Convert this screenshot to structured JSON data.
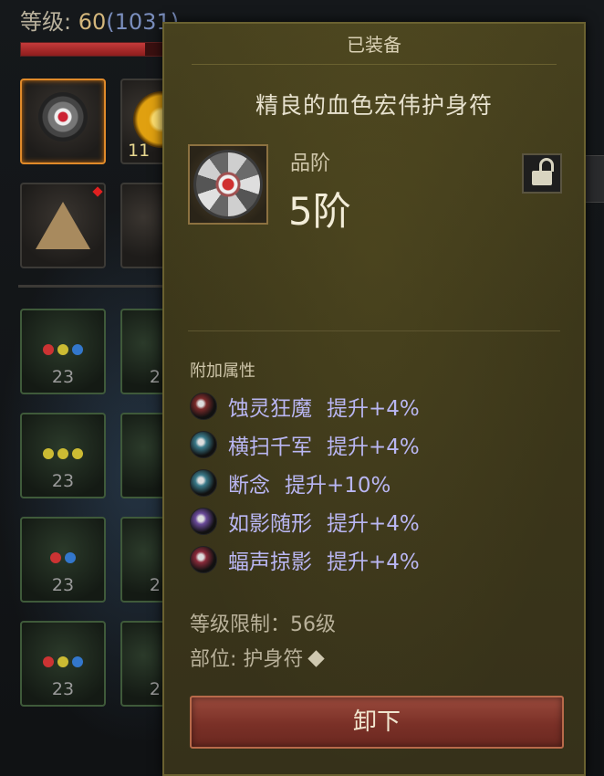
{
  "player": {
    "level_label": "等级: ",
    "level_value": "60",
    "level_extra": "(1031)",
    "hp_fraction": 0.85
  },
  "inventory": {
    "gold_count_partial": "11",
    "gem_slot_counts": [
      "23",
      "23",
      "23",
      "23"
    ],
    "partial_counts": [
      "2",
      "2",
      "2"
    ]
  },
  "tooltip": {
    "header": "已装备",
    "item_name": "精良的血色宏伟护身符",
    "grade_label": "品阶",
    "grade_value": "5阶",
    "attributes_header": "附加属性",
    "attributes": [
      {
        "name": "蚀灵狂魔",
        "bonus": "提升+4%",
        "icon": "dark-spirit-icon",
        "color": "#7a2a2a"
      },
      {
        "name": "横扫千军",
        "bonus": "提升+4%",
        "icon": "sweep-slash-icon",
        "color": "#3a7a8a"
      },
      {
        "name": "断念",
        "bonus": "提升+10%",
        "icon": "blade-icon",
        "color": "#3a7a8a"
      },
      {
        "name": "如影随形",
        "bonus": "提升+4%",
        "icon": "shadow-icon",
        "color": "#6a4a9a"
      },
      {
        "name": "蝠声掠影",
        "bonus": "提升+4%",
        "icon": "bat-swarm-icon",
        "color": "#8a2a3a"
      }
    ],
    "level_requirement": "等级限制：56级",
    "slot_label": "部位: 护身符",
    "slot_icon": "diamond-icon",
    "unequip_label": "卸下"
  },
  "colors": {
    "attribute_text": "#b9b6f2",
    "panel_bg": "#3c371a",
    "unequip_button": "#7a3027"
  }
}
